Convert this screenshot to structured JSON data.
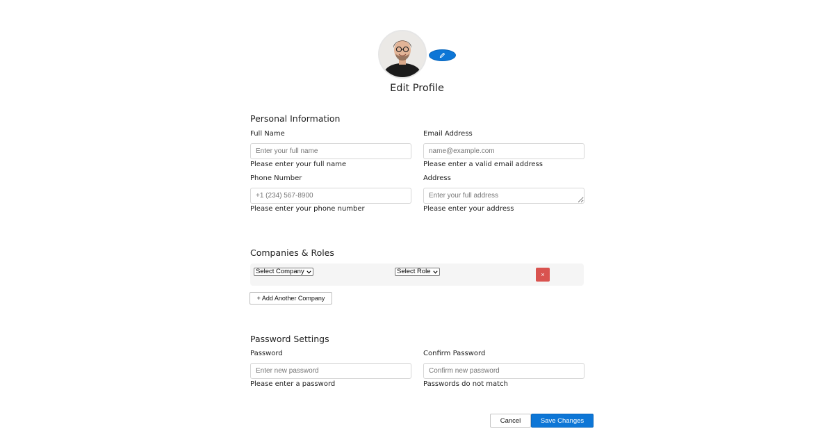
{
  "profile": {
    "title": "Edit Profile",
    "avatar_icon": "profile-photo",
    "edit_icon": "pencil-icon"
  },
  "personal": {
    "heading": "Personal Information",
    "full_name": {
      "label": "Full Name",
      "placeholder": "Enter your full name",
      "value": "",
      "help": "Please enter your full name"
    },
    "email": {
      "label": "Email Address",
      "placeholder": "name@example.com",
      "value": "",
      "help": "Please enter a valid email address"
    },
    "phone": {
      "label": "Phone Number",
      "placeholder": "+1 (234) 567-8900",
      "value": "",
      "help": "Please enter your phone number"
    },
    "address": {
      "label": "Address",
      "placeholder": "Enter your full address",
      "value": "",
      "help": "Please enter your address"
    }
  },
  "companies": {
    "heading": "Companies & Roles",
    "rows": [
      {
        "company": "Select Company",
        "role": "Select Role",
        "remove_label": "×"
      }
    ],
    "add_label": "+ Add Another Company"
  },
  "password": {
    "heading": "Password Settings",
    "password": {
      "label": "Password",
      "placeholder": "Enter new password",
      "help": "Please enter a password"
    },
    "confirm": {
      "label": "Confirm Password",
      "placeholder": "Confirm new password",
      "help": "Passwords do not match"
    }
  },
  "actions": {
    "cancel_label": "Cancel",
    "save_label": "Save Changes"
  },
  "colors": {
    "primary": "#0d76d6",
    "danger": "#d9534f",
    "row_background": "#f5f5f5"
  }
}
